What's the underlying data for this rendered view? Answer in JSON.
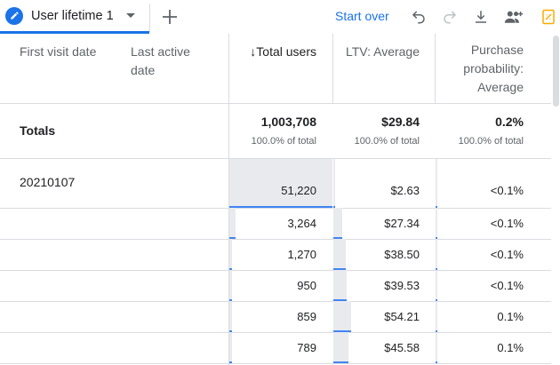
{
  "tab": {
    "label": "User lifetime 1"
  },
  "toolbar": {
    "start_over": "Start over"
  },
  "columns": {
    "first_visit": "First visit date",
    "last_active": "Last active date",
    "total_users": "Total users",
    "ltv": "LTV: Average",
    "purchase": "Purchase probability: Average",
    "sort_arrow": "↓"
  },
  "totals": {
    "label": "Totals",
    "total_users": "1,003,708",
    "total_users_pct": "100.0% of total",
    "ltv": "$29.84",
    "ltv_pct": "100.0% of total",
    "purchase": "0.2%",
    "purchase_pct": "100.0% of total"
  },
  "rows": [
    {
      "first_visit": "20210107",
      "total_users": "51,220",
      "ltv": "$2.63",
      "purchase": "<0.1%",
      "users_frac": 1.0,
      "ltv_frac": 0.05
    },
    {
      "first_visit": "",
      "total_users": "3,264",
      "ltv": "$27.34",
      "purchase": "<0.1%",
      "users_frac": 0.064,
      "ltv_frac": 0.5
    },
    {
      "first_visit": "",
      "total_users": "1,270",
      "ltv": "$38.50",
      "purchase": "<0.1%",
      "users_frac": 0.025,
      "ltv_frac": 0.71
    },
    {
      "first_visit": "",
      "total_users": "950",
      "ltv": "$39.53",
      "purchase": "<0.1%",
      "users_frac": 0.019,
      "ltv_frac": 0.73
    },
    {
      "first_visit": "",
      "total_users": "859",
      "ltv": "$54.21",
      "purchase": "0.1%",
      "users_frac": 0.017,
      "ltv_frac": 1.0
    },
    {
      "first_visit": "",
      "total_users": "789",
      "ltv": "$45.58",
      "purchase": "0.1%",
      "users_frac": 0.015,
      "ltv_frac": 0.84
    }
  ],
  "colors": {
    "accent": "#1a73e8",
    "bar": "#e8eaed",
    "bar_line": "#4285f4",
    "report_icon": "#f9ab00"
  },
  "icons": [
    "pencil-icon",
    "chevron-down-icon",
    "plus-icon",
    "undo-icon",
    "redo-icon",
    "download-icon",
    "share-users-icon",
    "report-icon"
  ]
}
